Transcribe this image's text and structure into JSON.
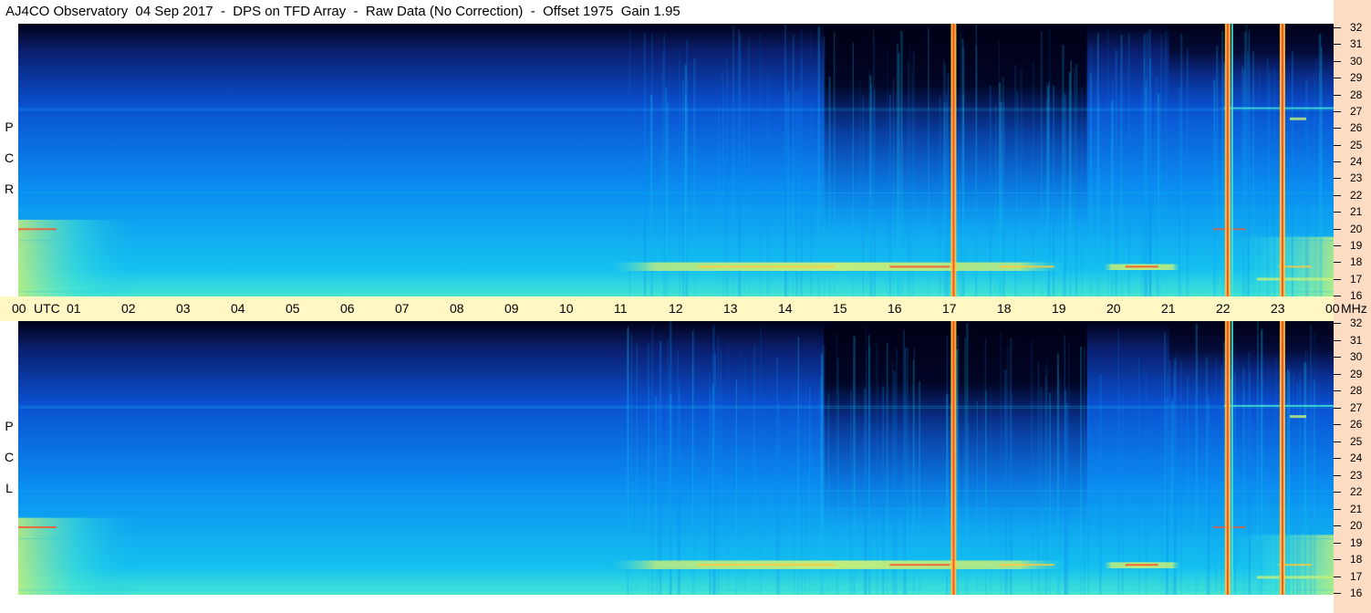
{
  "title": "AJ4CO Observatory  04 Sep 2017  -  DPS on TFD Array  -  Raw Data (No Correction)  -  Offset 1975  Gain 1.95",
  "panels": [
    {
      "name": "rcp",
      "letters": [
        "R",
        "C",
        "P"
      ]
    },
    {
      "name": "lcp",
      "letters": [
        "L",
        "C",
        "P"
      ]
    }
  ],
  "time_axis": {
    "labels": [
      "00",
      "UTC",
      "01",
      "02",
      "03",
      "04",
      "05",
      "06",
      "07",
      "08",
      "09",
      "10",
      "11",
      "12",
      "13",
      "14",
      "15",
      "16",
      "17",
      "18",
      "19",
      "20",
      "21",
      "22",
      "23",
      "00",
      "MHz"
    ]
  },
  "chart_data": {
    "type": "heatmap",
    "title": "AJ4CO Observatory  04 Sep 2017  -  DPS on TFD Array  -  Raw Data (No Correction)  -  Offset 1975  Gain 1.95",
    "x": {
      "unit": "UTC hour",
      "range": [
        0,
        24
      ],
      "ticks": [
        "00",
        "01",
        "02",
        "03",
        "04",
        "05",
        "06",
        "07",
        "08",
        "09",
        "10",
        "11",
        "12",
        "13",
        "14",
        "15",
        "16",
        "17",
        "18",
        "19",
        "20",
        "21",
        "22",
        "23",
        "00"
      ]
    },
    "y": {
      "unit": "MHz",
      "range": [
        16,
        32
      ],
      "ticks": [
        16,
        17,
        18,
        19,
        20,
        21,
        22,
        23,
        24,
        25,
        26,
        27,
        28,
        29,
        30,
        31,
        32
      ]
    },
    "series": [
      {
        "name": "RCP"
      },
      {
        "name": "LCP"
      }
    ],
    "vertical_lines_utc": [
      17.05,
      22.05,
      23.05
    ],
    "bright_band_mhz": [
      17.5,
      18.0
    ],
    "dark_region_utc": [
      14.7,
      19.5
    ],
    "colormap": [
      "#000018",
      "#0a1e6e",
      "#0a50d0",
      "#0a8cf0",
      "#14c0f0",
      "#46e6d2",
      "#c8f078",
      "#ffc83c",
      "#ff5028"
    ]
  }
}
